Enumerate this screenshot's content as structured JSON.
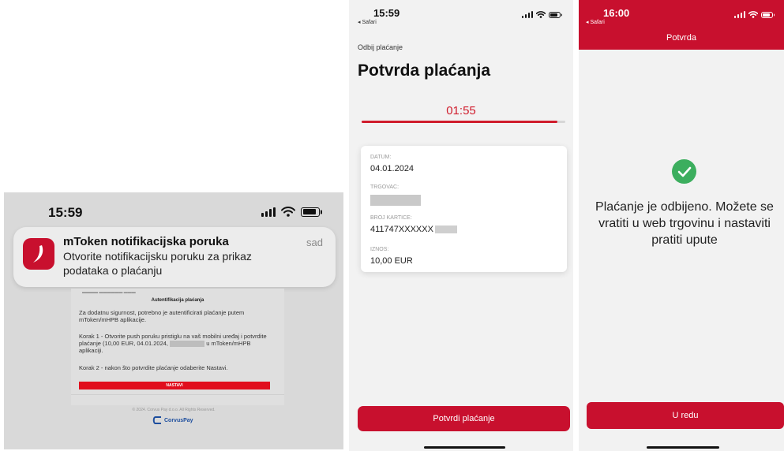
{
  "lock_screen": {
    "time": "15:59",
    "notification": {
      "title": "mToken notifikacijska poruka",
      "time": "sad",
      "body": "Otvorite notifikacijsku poruku za prikaz podataka o plaćanju"
    },
    "document": {
      "heading": "Autentifikacija plaćanja",
      "para1": "Za dodatnu sigurnost, potrebno je autentificirati plaćanje putem mToken/mHPB aplikacije.",
      "para2_prefix": "Korak 1 - Otvorite push poruku pristiglu na vaš mobilni uređaj i potvrdite plaćanje (10,00 EUR, 04.01.2024,",
      "para2_suffix": "u mToken/mHPB aplikaciji.",
      "para3": "Korak 2 - nakon što potvrdite plaćanje odaberite Nastavi.",
      "button_label": "NASTAVI",
      "copyright": "© 2024. Corvus Pay d.o.o. All Rights Reserved.",
      "brand": "CorvusPay"
    }
  },
  "confirm_screen": {
    "time": "15:59",
    "back_label": "◂ Safari",
    "reject_link": "Odbij plaćanje",
    "title": "Potvrda plaćanja",
    "countdown": "01:55",
    "progress_fraction": 0.96,
    "card": {
      "date_label": "DATUM:",
      "date_value": "04.01.2024",
      "merchant_label": "TRGOVAC:",
      "card_label": "BROJ KARTICE:",
      "card_value": "411747XXXXXX",
      "amount_label": "IZNOS:",
      "amount_value": "10,00 EUR"
    },
    "confirm_button": "Potvrdi plaćanje"
  },
  "result_screen": {
    "time": "16:00",
    "back_label": "◂ Safari",
    "header_title": "Potvrda",
    "message": "Plaćanje je odbijeno. Možete se vratiti u web trgovinu i nastaviti pratiti upute",
    "ok_button": "U redu"
  },
  "colors": {
    "brand_red": "#c8102e",
    "success_green": "#3cae5e"
  }
}
